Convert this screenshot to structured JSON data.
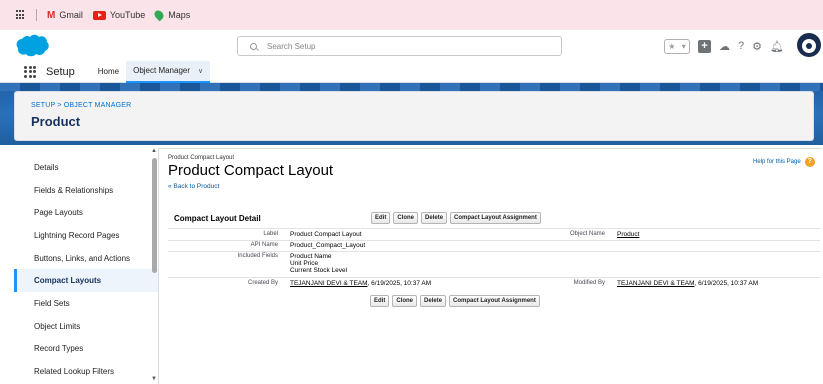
{
  "bookmarks": {
    "gmail": "Gmail",
    "youtube": "YouTube",
    "maps": "Maps"
  },
  "header": {
    "search_placeholder": "Search Setup"
  },
  "appnav": {
    "app_name": "Setup",
    "tabs": [
      "Home",
      "Object Manager"
    ]
  },
  "page_header": {
    "breadcrumb": "SETUP > OBJECT MANAGER",
    "title": "Product"
  },
  "sidebar": {
    "items": [
      "Details",
      "Fields & Relationships",
      "Page Layouts",
      "Lightning Record Pages",
      "Buttons, Links, and Actions",
      "Compact Layouts",
      "Field Sets",
      "Object Limits",
      "Record Types",
      "Related Lookup Filters"
    ],
    "active_index": 5
  },
  "content": {
    "sub_label": "Product Compact Layout",
    "title": "Product Compact Layout",
    "back_link": "« Back to Product",
    "help_link": "Help for this Page"
  },
  "detail": {
    "section_title": "Compact Layout Detail",
    "buttons": [
      "Edit",
      "Clone",
      "Delete",
      "Compact Layout Assignment"
    ],
    "label_label": "Label",
    "label_value": "Product Compact Layout",
    "object_name_label": "Object Name",
    "object_name_value": "Product",
    "api_name_label": "API Name",
    "api_name_value": "Product_Compact_Layout",
    "included_fields_label": "Included Fields",
    "included_fields": [
      "Product Name",
      "Unit Price",
      "Current Stock Level"
    ],
    "created_by_label": "Created By",
    "created_by_user": "TEJANJANI DEVI & TEAM",
    "created_by_date": ", 6/19/2025, 10:37 AM",
    "modified_by_label": "Modified By",
    "modified_by_user": "TEJANJANI DEVI & TEAM",
    "modified_by_date": ", 6/19/2025, 10:37 AM"
  },
  "colors": {
    "brand_blue": "#0070d2",
    "band_blue": "#1f5fa6",
    "bookmark_bar": "#fbe3ea"
  }
}
